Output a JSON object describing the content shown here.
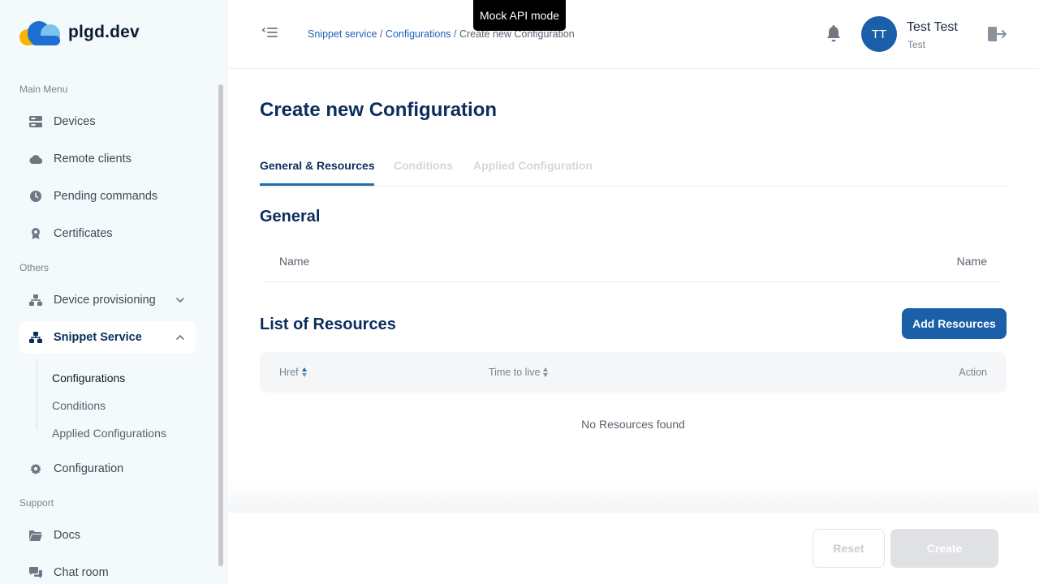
{
  "app": {
    "logo_text": "plgd.dev",
    "mock_badge": "Mock API mode"
  },
  "sidebar": {
    "main_menu_label": "Main Menu",
    "others_label": "Others",
    "support_label": "Support",
    "items": [
      {
        "label": "Devices",
        "icon": "devices-icon"
      },
      {
        "label": "Remote clients",
        "icon": "cloud-icon"
      },
      {
        "label": "Pending commands",
        "icon": "clock-icon"
      },
      {
        "label": "Certificates",
        "icon": "certificate-icon"
      },
      {
        "label": "Device provisioning",
        "icon": "network-icon"
      },
      {
        "label": "Snippet Service",
        "icon": "network-icon",
        "active": true
      },
      {
        "label": "Configuration",
        "icon": "gear-icon"
      },
      {
        "label": "Docs",
        "icon": "folder-icon"
      },
      {
        "label": "Chat room",
        "icon": "chat-icon"
      }
    ],
    "sub_items": [
      {
        "label": "Configurations",
        "current": true
      },
      {
        "label": "Conditions"
      },
      {
        "label": "Applied Configurations"
      }
    ]
  },
  "header": {
    "breadcrumb": [
      {
        "label": "Snippet service",
        "link": true
      },
      {
        "label": "Configurations",
        "link": true
      },
      {
        "label": "Create new Configuration",
        "link": false
      }
    ],
    "separator": "/",
    "user": {
      "initials": "TT",
      "name": "Test Test",
      "role": "Test"
    }
  },
  "main": {
    "title": "Create new Configuration",
    "tabs": [
      {
        "label": "General & Resources",
        "active": true
      },
      {
        "label": "Conditions"
      },
      {
        "label": "Applied Configuration"
      }
    ],
    "general": {
      "heading": "General",
      "field_label": "Name",
      "field_value": "Name"
    },
    "resources": {
      "heading": "List of Resources",
      "add_button": "Add Resources",
      "columns": [
        "Href",
        "Time to live",
        "Action"
      ],
      "empty_text": "No Resources found"
    }
  },
  "footer": {
    "reset_label": "Reset",
    "create_label": "Create"
  },
  "colors": {
    "brand": "#1b5fa8",
    "title": "#0c2d5c",
    "sidebar_bg": "#f4f9fc"
  }
}
